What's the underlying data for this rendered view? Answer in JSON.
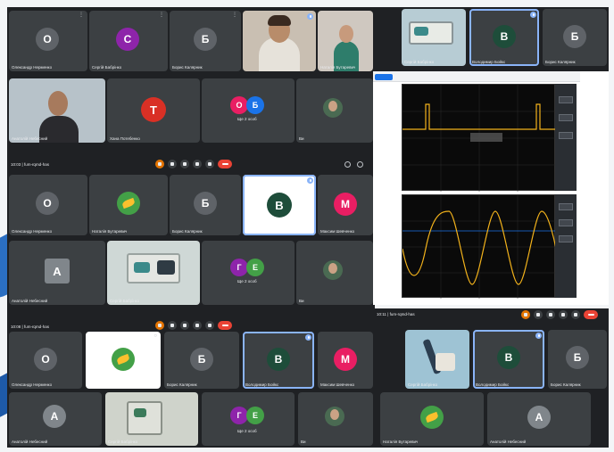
{
  "avatar_colors": {
    "grey": "#5f6368",
    "purple": "#8e24aa",
    "green": "#1e4d3a",
    "red": "#d93025",
    "pink": "#e91e63",
    "orange": "#e37400",
    "blue": "#1a73e8",
    "leaf": "#43a047"
  },
  "meeting": {
    "code": "fum-rqmd-has",
    "time_1": "10:03",
    "time_2": "10:08",
    "time_3": "10:11"
  },
  "letters": {
    "o": "O",
    "c": "C",
    "b_cyr": "Б",
    "v_cyr": "В",
    "t": "T",
    "m_cyr": "M",
    "a": "A",
    "g_cyr": "Г",
    "e_cyr": "Е"
  },
  "names": {
    "oleksandr": "Олександр Нерменко",
    "serhii": "Сергій Бабрінко",
    "borys": "Борис Калярник",
    "natalia": "Наталія Бутаревич",
    "volodymyr": "Володимир Бойко",
    "anatolii": "Анатолій Небесний",
    "khan": "Хана Потебенко",
    "maksym": "Максим Шевченко",
    "you": "Ви",
    "more_2": "Ще 2 особ"
  },
  "scope": {
    "top_trace": "pulse",
    "bottom_trace": "sine"
  }
}
